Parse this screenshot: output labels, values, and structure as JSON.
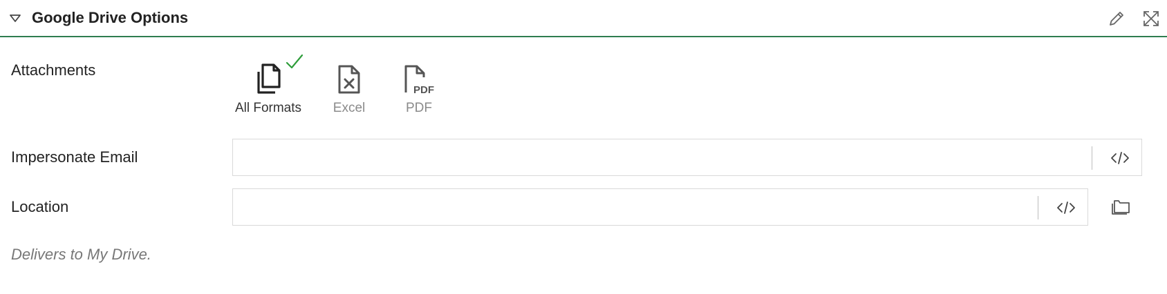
{
  "panel": {
    "title": "Google Drive Options",
    "accent_color": "#2e7d4f"
  },
  "attachments": {
    "label": "Attachments",
    "selected": "All Formats",
    "check_color": "#2e9d3a",
    "formats": [
      {
        "label": "All Formats",
        "icon": "files-icon",
        "selected": true
      },
      {
        "label": "Excel",
        "icon": "excel-file-icon",
        "selected": false
      },
      {
        "label": "PDF",
        "icon": "pdf-file-icon",
        "selected": false
      }
    ]
  },
  "impersonate_email": {
    "label": "Impersonate Email",
    "value": "",
    "placeholder": ""
  },
  "location": {
    "label": "Location",
    "value": "",
    "placeholder": ""
  },
  "hint": "Delivers to My Drive."
}
